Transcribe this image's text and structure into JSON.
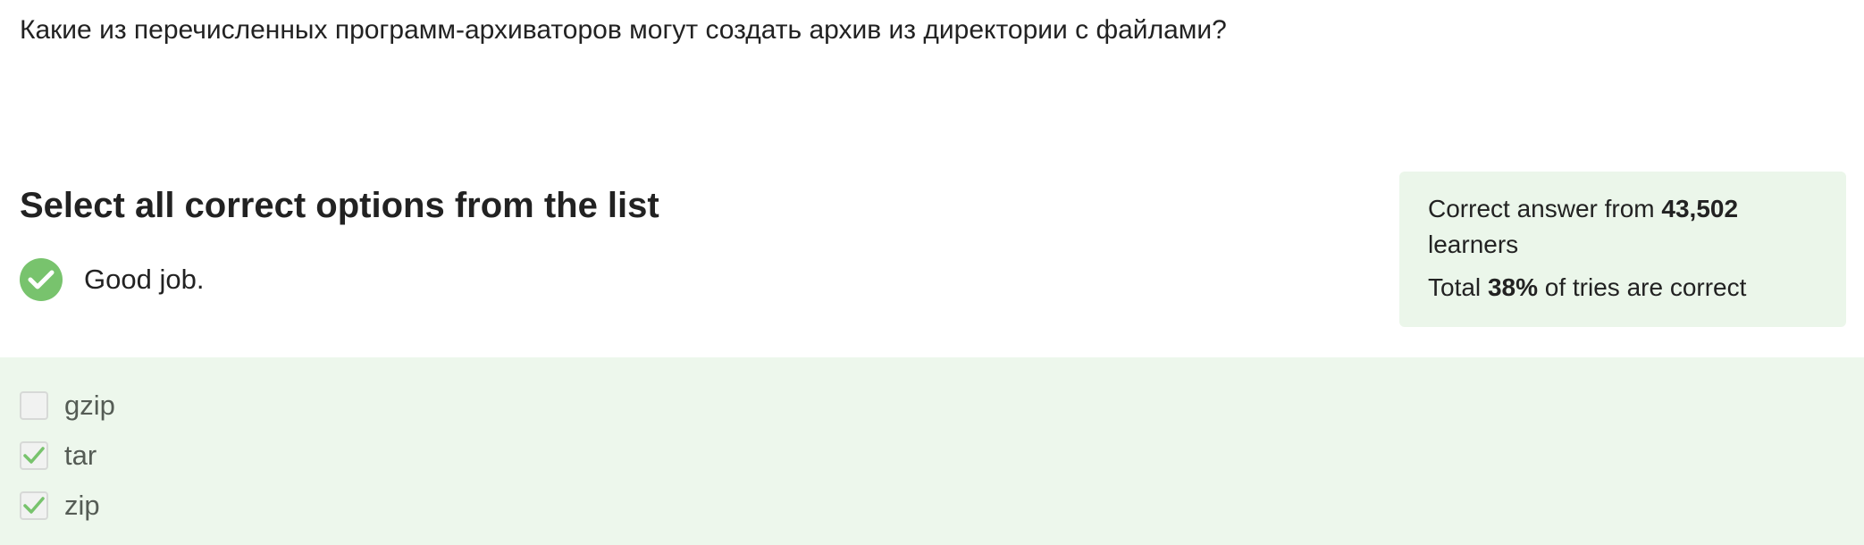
{
  "question": {
    "text": "Какие из перечисленных программ-архиваторов могут создать архив из директории с файлами?"
  },
  "task": {
    "heading": "Select all correct options from the list"
  },
  "feedback": {
    "icon": "check-circle-icon",
    "text": "Good job."
  },
  "stats": {
    "line1_prefix": "Correct answer from ",
    "learners_count": "43,502",
    "line1_suffix": " learners",
    "line2_prefix": "Total ",
    "percent_correct": "38%",
    "line2_suffix": " of tries are correct"
  },
  "options": [
    {
      "label": "gzip",
      "checked": false
    },
    {
      "label": "tar",
      "checked": true
    },
    {
      "label": "zip",
      "checked": true
    }
  ],
  "colors": {
    "success": "#78c36d",
    "success_background": "#ebf6ea",
    "text": "#222222"
  }
}
